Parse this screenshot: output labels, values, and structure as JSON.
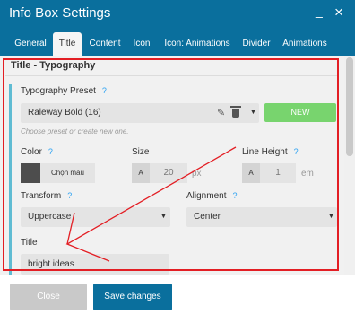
{
  "window": {
    "title": "Info Box Settings",
    "minimize": "_",
    "close": "×"
  },
  "tabs": [
    {
      "label": "General"
    },
    {
      "label": "Title",
      "active": true
    },
    {
      "label": "Content"
    },
    {
      "label": "Icon"
    },
    {
      "label": "Icon: Animations"
    },
    {
      "label": "Divider"
    },
    {
      "label": "Animations"
    }
  ],
  "section": {
    "title": "Title - Typography"
  },
  "preset": {
    "label": "Typography Preset",
    "value": "Raleway Bold (16)",
    "new_button": "NEW",
    "hint": "Choose preset or create new one."
  },
  "color": {
    "label": "Color",
    "button": "Chọn màu",
    "swatch": "#4d4d4d"
  },
  "size": {
    "label": "Size",
    "prefix": "A",
    "value": "20",
    "unit": "px"
  },
  "line_height": {
    "label": "Line Height",
    "prefix": "A",
    "value": "1",
    "unit": "em"
  },
  "transform": {
    "label": "Transform",
    "value": "Uppercase"
  },
  "alignment": {
    "label": "Alignment",
    "value": "Center"
  },
  "title_field": {
    "label": "Title",
    "value": "bright ideas"
  },
  "help_icon": "?",
  "footer": {
    "close": "Close",
    "save": "Save changes"
  },
  "colors": {
    "header": "#0a6f9d",
    "accent": "#5fbcd3",
    "new_button": "#78d46e",
    "annotation": "#e31e24"
  }
}
